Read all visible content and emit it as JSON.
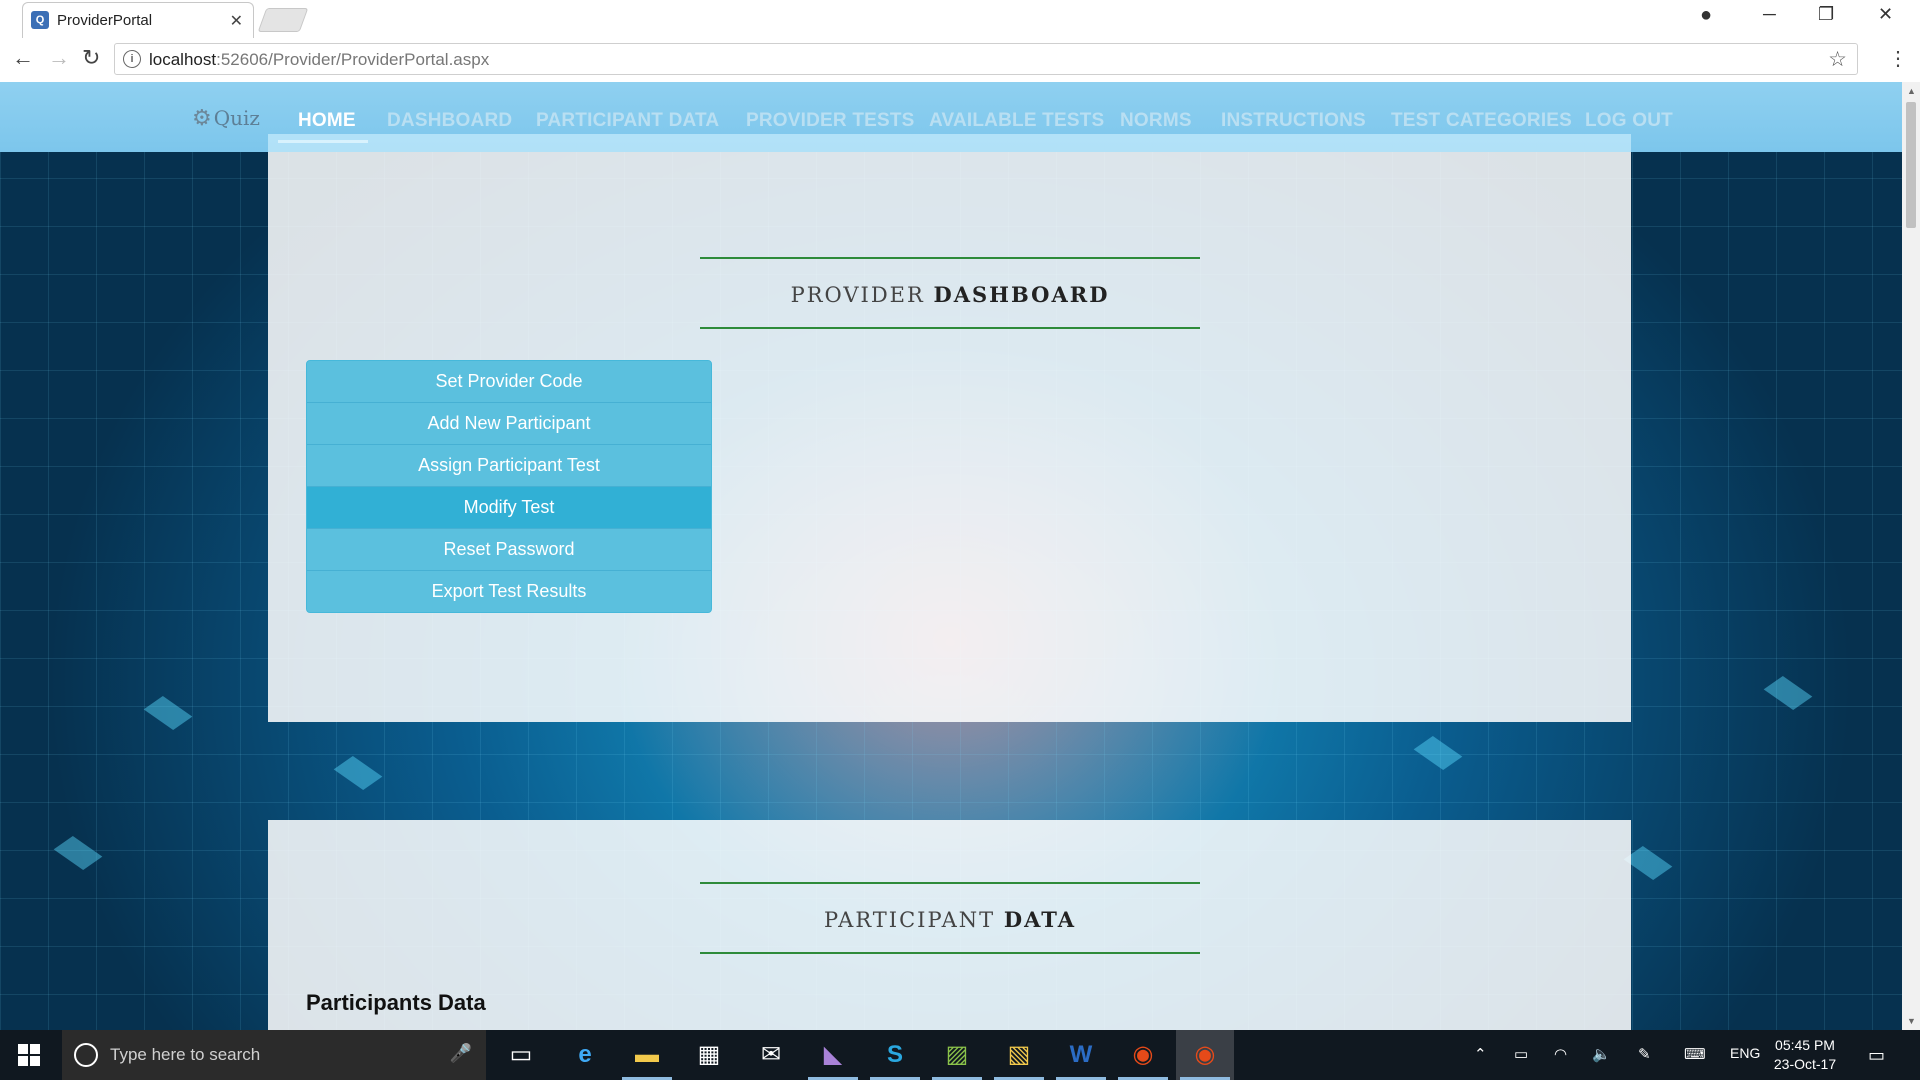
{
  "browser": {
    "tab_title": "ProviderPortal",
    "favicon": "portal-favicon",
    "url_host": "localhost",
    "url_path": ":52606/Provider/ProviderPortal.aspx"
  },
  "site": {
    "logo_text": "Quiz",
    "nav": [
      {
        "label": "HOME",
        "active": true
      },
      {
        "label": "DASHBOARD",
        "active": false
      },
      {
        "label": "PARTICIPANT DATA",
        "active": false
      },
      {
        "label": "PROVIDER TESTS",
        "active": false
      },
      {
        "label": "AVAILABLE TESTS",
        "active": false
      },
      {
        "label": "NORMS",
        "active": false
      },
      {
        "label": "INSTRUCTIONS",
        "active": false
      },
      {
        "label": "TEST CATEGORIES",
        "active": false
      },
      {
        "label": "LOG OUT",
        "active": false
      }
    ]
  },
  "dashboard": {
    "title_light": "PROVIDER ",
    "title_bold": "DASHBOARD",
    "actions": [
      {
        "label": "Set Provider Code",
        "active": false
      },
      {
        "label": "Add New Participant",
        "active": false
      },
      {
        "label": "Assign Participant Test",
        "active": false
      },
      {
        "label": "Modify Test",
        "active": true
      },
      {
        "label": "Reset Password",
        "active": false
      },
      {
        "label": "Export Test Results",
        "active": false
      }
    ]
  },
  "participant_section": {
    "title_light": "PARTICIPANT ",
    "title_bold": "DATA",
    "heading": "Participants Data"
  },
  "taskbar": {
    "search_placeholder": "Type here to search",
    "language": "ENG",
    "time": "05:45 PM",
    "date": "23-Oct-17"
  },
  "colors": {
    "button_bg": "#5bc0de",
    "button_active_bg": "#31b0d5",
    "section_rule": "#2e8b3a",
    "nav_bg": "#8fd0f0"
  }
}
